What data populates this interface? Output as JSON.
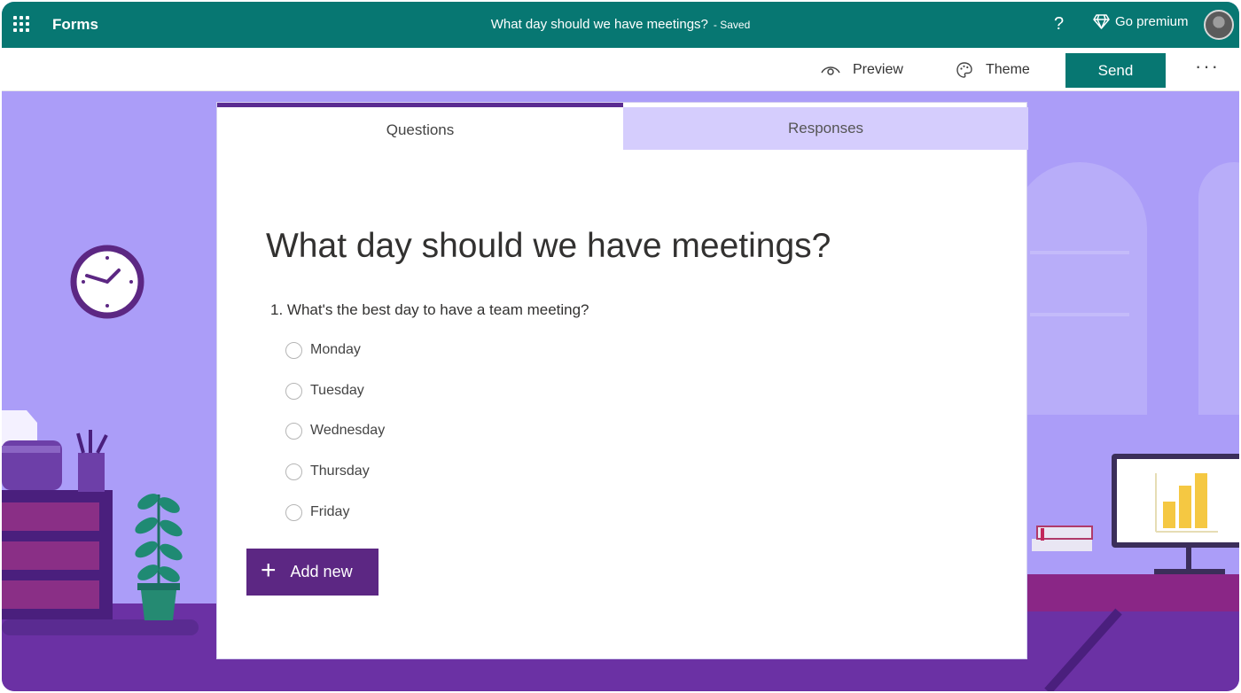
{
  "appbar": {
    "app_name": "Forms",
    "doc_title": "What day should we have meetings?",
    "saved_status": "- Saved",
    "help_label": "?",
    "premium_label": "Go premium"
  },
  "toolbar": {
    "preview_label": "Preview",
    "theme_label": "Theme",
    "send_label": "Send",
    "more_label": "···"
  },
  "tabs": [
    {
      "label": "Questions"
    },
    {
      "label": "Responses"
    }
  ],
  "form": {
    "title": "What day should we have meetings?",
    "question": "1. What's the best day to have a team meeting?",
    "options": [
      {
        "label": "Monday"
      },
      {
        "label": "Tuesday"
      },
      {
        "label": "Wednesday"
      },
      {
        "label": "Thursday"
      },
      {
        "label": "Friday"
      }
    ],
    "add_new_label": "Add new"
  },
  "colors": {
    "brand_teal": "#077772",
    "accent_purple": "#5c2783",
    "background_lavender": "#ab9df8"
  }
}
